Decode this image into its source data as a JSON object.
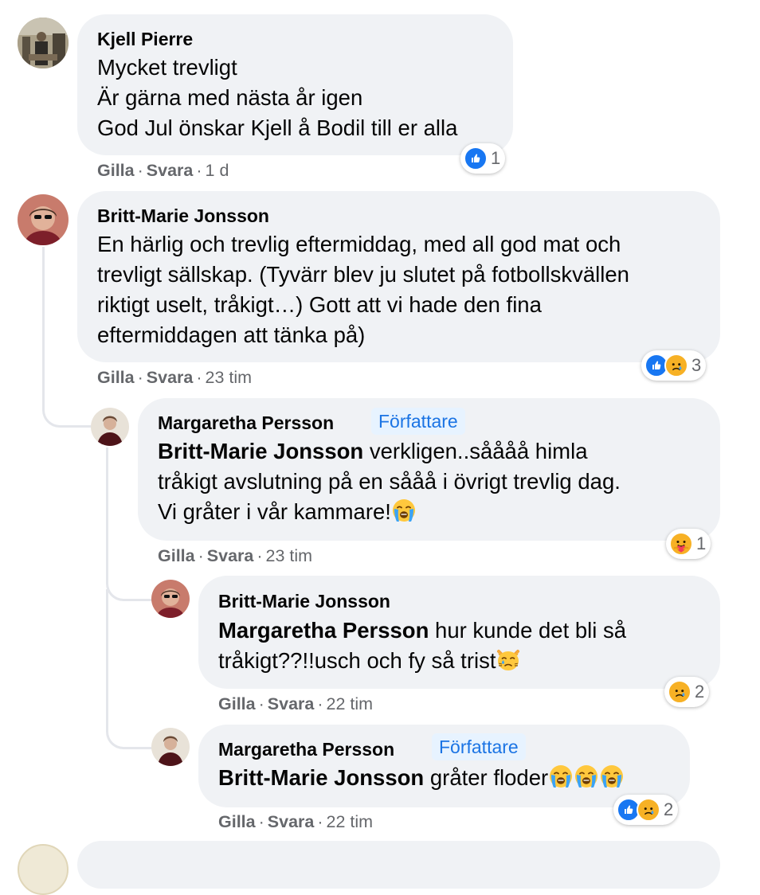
{
  "comments": [
    {
      "author": "Kjell Pierre",
      "lines": [
        "Mycket trevligt",
        "Är gärna med nästa år igen",
        "God Jul önskar Kjell å Bodil till er alla"
      ],
      "actions": {
        "like": "Gilla",
        "reply": "Svara",
        "time": "1 d"
      },
      "reactions": {
        "icons": [
          "like"
        ],
        "count": "1"
      }
    },
    {
      "author": "Britt-Marie Jonsson",
      "lines": [
        "En härlig och trevlig eftermiddag, med all god mat och",
        "trevligt sällskap. (Tyvärr blev ju slutet på fotbollskvällen",
        "riktigt uselt, tråkigt…) Gott att vi hade den fina",
        "eftermiddagen att tänka på)"
      ],
      "actions": {
        "like": "Gilla",
        "reply": "Svara",
        "time": "23 tim"
      },
      "reactions": {
        "icons": [
          "like",
          "sad"
        ],
        "count": "3"
      }
    }
  ],
  "replies": [
    {
      "author": "Margaretha Persson",
      "badge": "Författare",
      "mention": "Britt-Marie Jonsson",
      "line1_rest": "verkligen..såååå himla",
      "line2": "tråkigt avslutning på en sååå i övrigt trevlig dag.",
      "line3": "Vi gråter i vår kammare!",
      "emojis": [
        "loudly-crying-face"
      ],
      "actions": {
        "like": "Gilla",
        "reply": "Svara",
        "time": "23 tim"
      },
      "reactions": {
        "icons": [
          "care"
        ],
        "count": "1"
      }
    },
    {
      "author": "Britt-Marie Jonsson",
      "mention": "Margaretha Persson",
      "line1_rest": "hur kunde det bli så",
      "line2": "tråkigt??!!usch och fy så trist",
      "emojis": [
        "crying-cat-face"
      ],
      "actions": {
        "like": "Gilla",
        "reply": "Svara",
        "time": "22 tim"
      },
      "reactions": {
        "icons": [
          "sad"
        ],
        "count": "2"
      }
    },
    {
      "author": "Margaretha Persson",
      "badge": "Författare",
      "mention": "Britt-Marie Jonsson",
      "line1_rest": "gråter floder",
      "emojis": [
        "loudly-crying-face",
        "loudly-crying-face",
        "loudly-crying-face"
      ],
      "actions": {
        "like": "Gilla",
        "reply": "Svara",
        "time": "22 tim"
      },
      "reactions": {
        "icons": [
          "like",
          "sad"
        ],
        "count": "2"
      }
    }
  ],
  "colors": {
    "bubble": "#f0f2f5",
    "meta": "#65676b",
    "like": "#1877f2",
    "badge_bg": "#e7f3ff",
    "badge_text": "#1b74e4"
  }
}
